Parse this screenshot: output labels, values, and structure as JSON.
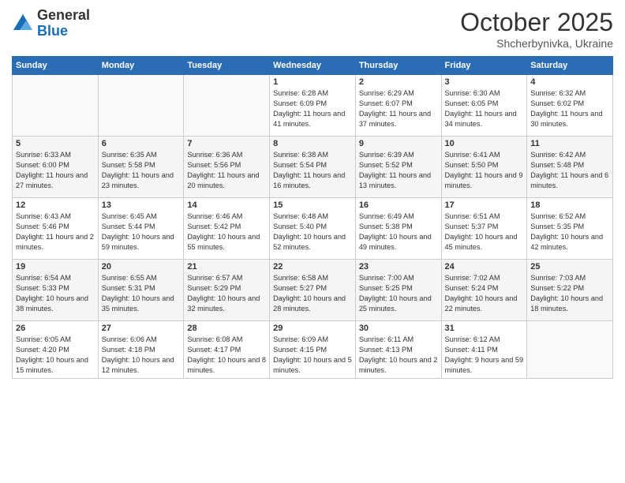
{
  "header": {
    "logo_general": "General",
    "logo_blue": "Blue",
    "month": "October 2025",
    "location": "Shcherbynivka, Ukraine"
  },
  "weekdays": [
    "Sunday",
    "Monday",
    "Tuesday",
    "Wednesday",
    "Thursday",
    "Friday",
    "Saturday"
  ],
  "weeks": [
    [
      {
        "day": "",
        "info": ""
      },
      {
        "day": "",
        "info": ""
      },
      {
        "day": "",
        "info": ""
      },
      {
        "day": "1",
        "info": "Sunrise: 6:28 AM\nSunset: 6:09 PM\nDaylight: 11 hours\nand 41 minutes."
      },
      {
        "day": "2",
        "info": "Sunrise: 6:29 AM\nSunset: 6:07 PM\nDaylight: 11 hours\nand 37 minutes."
      },
      {
        "day": "3",
        "info": "Sunrise: 6:30 AM\nSunset: 6:05 PM\nDaylight: 11 hours\nand 34 minutes."
      },
      {
        "day": "4",
        "info": "Sunrise: 6:32 AM\nSunset: 6:02 PM\nDaylight: 11 hours\nand 30 minutes."
      }
    ],
    [
      {
        "day": "5",
        "info": "Sunrise: 6:33 AM\nSunset: 6:00 PM\nDaylight: 11 hours\nand 27 minutes."
      },
      {
        "day": "6",
        "info": "Sunrise: 6:35 AM\nSunset: 5:58 PM\nDaylight: 11 hours\nand 23 minutes."
      },
      {
        "day": "7",
        "info": "Sunrise: 6:36 AM\nSunset: 5:56 PM\nDaylight: 11 hours\nand 20 minutes."
      },
      {
        "day": "8",
        "info": "Sunrise: 6:38 AM\nSunset: 5:54 PM\nDaylight: 11 hours\nand 16 minutes."
      },
      {
        "day": "9",
        "info": "Sunrise: 6:39 AM\nSunset: 5:52 PM\nDaylight: 11 hours\nand 13 minutes."
      },
      {
        "day": "10",
        "info": "Sunrise: 6:41 AM\nSunset: 5:50 PM\nDaylight: 11 hours\nand 9 minutes."
      },
      {
        "day": "11",
        "info": "Sunrise: 6:42 AM\nSunset: 5:48 PM\nDaylight: 11 hours\nand 6 minutes."
      }
    ],
    [
      {
        "day": "12",
        "info": "Sunrise: 6:43 AM\nSunset: 5:46 PM\nDaylight: 11 hours\nand 2 minutes."
      },
      {
        "day": "13",
        "info": "Sunrise: 6:45 AM\nSunset: 5:44 PM\nDaylight: 10 hours\nand 59 minutes."
      },
      {
        "day": "14",
        "info": "Sunrise: 6:46 AM\nSunset: 5:42 PM\nDaylight: 10 hours\nand 55 minutes."
      },
      {
        "day": "15",
        "info": "Sunrise: 6:48 AM\nSunset: 5:40 PM\nDaylight: 10 hours\nand 52 minutes."
      },
      {
        "day": "16",
        "info": "Sunrise: 6:49 AM\nSunset: 5:38 PM\nDaylight: 10 hours\nand 49 minutes."
      },
      {
        "day": "17",
        "info": "Sunrise: 6:51 AM\nSunset: 5:37 PM\nDaylight: 10 hours\nand 45 minutes."
      },
      {
        "day": "18",
        "info": "Sunrise: 6:52 AM\nSunset: 5:35 PM\nDaylight: 10 hours\nand 42 minutes."
      }
    ],
    [
      {
        "day": "19",
        "info": "Sunrise: 6:54 AM\nSunset: 5:33 PM\nDaylight: 10 hours\nand 38 minutes."
      },
      {
        "day": "20",
        "info": "Sunrise: 6:55 AM\nSunset: 5:31 PM\nDaylight: 10 hours\nand 35 minutes."
      },
      {
        "day": "21",
        "info": "Sunrise: 6:57 AM\nSunset: 5:29 PM\nDaylight: 10 hours\nand 32 minutes."
      },
      {
        "day": "22",
        "info": "Sunrise: 6:58 AM\nSunset: 5:27 PM\nDaylight: 10 hours\nand 28 minutes."
      },
      {
        "day": "23",
        "info": "Sunrise: 7:00 AM\nSunset: 5:25 PM\nDaylight: 10 hours\nand 25 minutes."
      },
      {
        "day": "24",
        "info": "Sunrise: 7:02 AM\nSunset: 5:24 PM\nDaylight: 10 hours\nand 22 minutes."
      },
      {
        "day": "25",
        "info": "Sunrise: 7:03 AM\nSunset: 5:22 PM\nDaylight: 10 hours\nand 18 minutes."
      }
    ],
    [
      {
        "day": "26",
        "info": "Sunrise: 6:05 AM\nSunset: 4:20 PM\nDaylight: 10 hours\nand 15 minutes."
      },
      {
        "day": "27",
        "info": "Sunrise: 6:06 AM\nSunset: 4:18 PM\nDaylight: 10 hours\nand 12 minutes."
      },
      {
        "day": "28",
        "info": "Sunrise: 6:08 AM\nSunset: 4:17 PM\nDaylight: 10 hours\nand 8 minutes."
      },
      {
        "day": "29",
        "info": "Sunrise: 6:09 AM\nSunset: 4:15 PM\nDaylight: 10 hours\nand 5 minutes."
      },
      {
        "day": "30",
        "info": "Sunrise: 6:11 AM\nSunset: 4:13 PM\nDaylight: 10 hours\nand 2 minutes."
      },
      {
        "day": "31",
        "info": "Sunrise: 6:12 AM\nSunset: 4:11 PM\nDaylight: 9 hours\nand 59 minutes."
      },
      {
        "day": "",
        "info": ""
      }
    ]
  ]
}
